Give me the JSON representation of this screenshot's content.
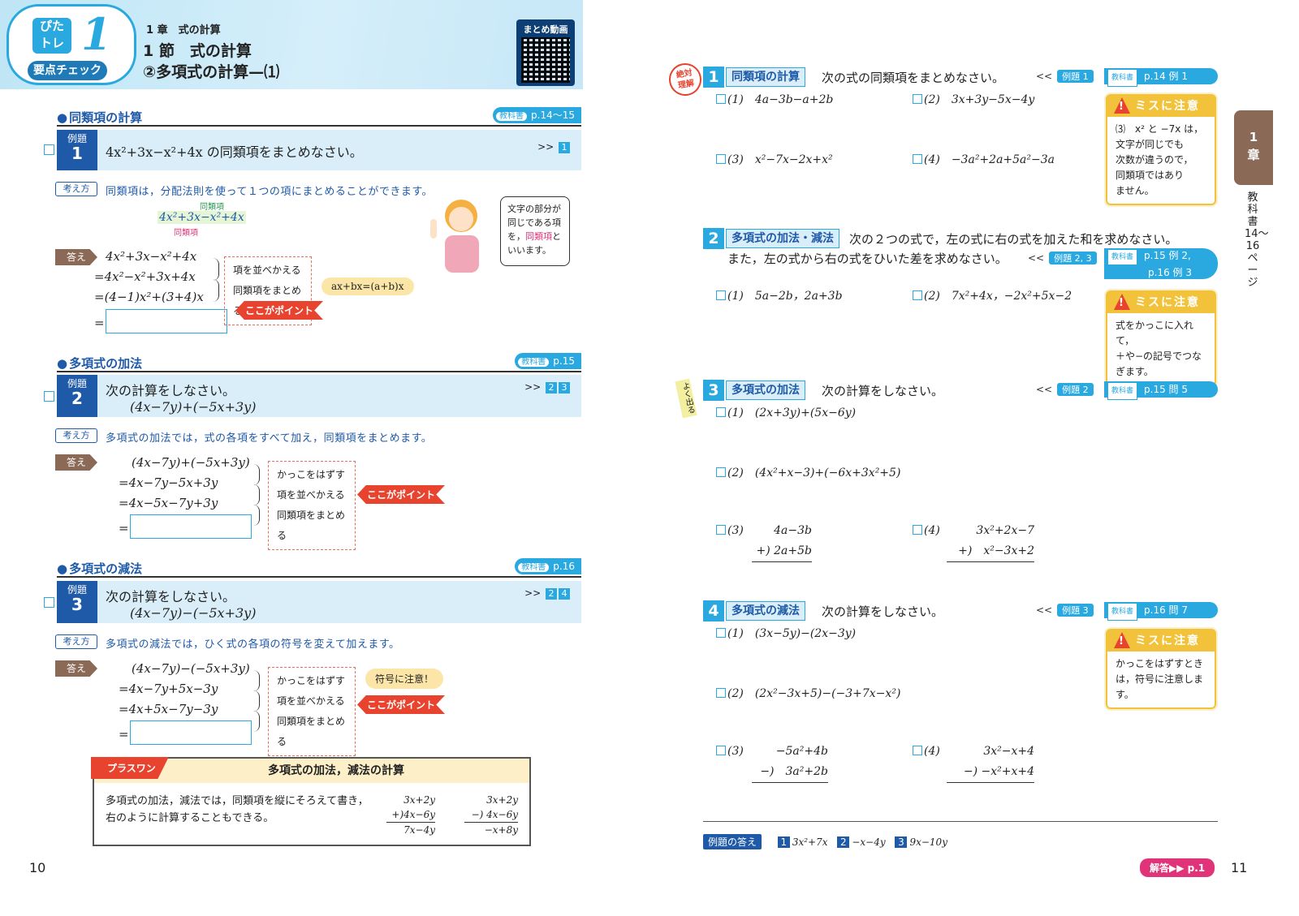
{
  "left": {
    "badge": {
      "pita": "ぴた\nトレ",
      "num": "1",
      "yoten": "要点チェック"
    },
    "chapter": "1 章　式の計算",
    "section": "1 節　式の計算",
    "subsection": "②多項式の計算—⑴",
    "qr_label": "まとめ動画",
    "s1": {
      "title": "同類項の計算",
      "tag_small": "教科書",
      "tag": "p.14〜15",
      "ex_label": "例題",
      "ex_num": "1",
      "question": "4x²+3x−x²+4x の同類項をまとめなさい。",
      "ref": ">>",
      "refs": [
        "1"
      ],
      "kk": "考え方",
      "kk_text": "同類項は，分配法則を使って１つの項にまとめることができます。",
      "diagram": "4x²+3x−x²+4x",
      "diag_top": "同類項",
      "diag_bottom": "同類項",
      "ans": "答え",
      "lines": [
        "4x²+3x−x²+4x",
        "=4x²−x²+3x+4x",
        "=(4−1)x²+(3+4)x",
        "="
      ],
      "notes": [
        "項を並べかえる",
        "同類項をまとめる"
      ],
      "point": "ここがポイント",
      "bubble": "ax+bx=(a+b)x",
      "speech": [
        "文字の部分が",
        "同じである項",
        "を，",
        "同類項",
        "と",
        "いいます。"
      ]
    },
    "s2": {
      "title": "多項式の加法",
      "tag_small": "教科書",
      "tag": "p.15",
      "ex_label": "例題",
      "ex_num": "2",
      "q1": "次の計算をしなさい。",
      "q2": "(4x−7y)+(−5x+3y)",
      "ref": ">>",
      "refs": [
        "2",
        "3"
      ],
      "kk": "考え方",
      "kk_text": "多項式の加法では，式の各項をすべて加え，同類項をまとめます。",
      "ans": "答え",
      "lines": [
        "(4x−7y)+(−5x+3y)",
        "=4x−7y−5x+3y",
        "=4x−5x−7y+3y",
        "="
      ],
      "notes": [
        "かっこをはずす",
        "項を並べかえる",
        "同類項をまとめる"
      ],
      "point": "ここがポイント"
    },
    "s3": {
      "title": "多項式の減法",
      "tag_small": "教科書",
      "tag": "p.16",
      "ex_label": "例題",
      "ex_num": "3",
      "q1": "次の計算をしなさい。",
      "q2": "(4x−7y)−(−5x+3y)",
      "ref": ">>",
      "refs": [
        "2",
        "4"
      ],
      "kk": "考え方",
      "kk_text": "多項式の減法では，ひく式の各項の符号を変えて加えます。",
      "ans": "答え",
      "lines": [
        "(4x−7y)−(−5x+3y)",
        "=4x−7y+5x−3y",
        "=4x+5x−7y−3y",
        "="
      ],
      "notes": [
        "かっこをはずす",
        "項を並べかえる",
        "同類項をまとめる"
      ],
      "point": "ここがポイント",
      "bubble": "符号に注意！"
    },
    "plus": {
      "tag": "プラスワン",
      "title": "多項式の加法，減法の計算",
      "text1": "多項式の加法，減法では，同類項を縦にそろえて書き，",
      "text2": "右のように計算することもできる。",
      "c1": [
        "3x+2y",
        "+)4x−6y",
        "7x−4y"
      ],
      "c2": [
        "3x+2y",
        "−) 4x−6y",
        "−x+8y"
      ]
    },
    "page_num": "10"
  },
  "right": {
    "stamp": "絶対\n理解",
    "yoku": "よく出る",
    "q1": {
      "num": "1",
      "title": "同類項の計算",
      "text": "次の式の同類項をまとめなさい。",
      "ex": "例題 1",
      "tb_small": "教科書",
      "tb": "p.14 例 1",
      "items": [
        "(1)　4a−3b−a+2b",
        "(2)　3x+3y−5x−4y",
        "(3)　x²−7x−2x+x²",
        "(4)　−3a²+2a+5a²−3a"
      ],
      "warn_title": "ミスに注意",
      "warn": [
        "⑶　x² と −7x は，",
        "文字が同じでも",
        "次数が違うので，",
        "同類項ではあり",
        "ません。"
      ]
    },
    "q2": {
      "num": "2",
      "title": "多項式の加法・減法",
      "text1": "次の２つの式で，左の式に右の式を加えた和を求めなさい。",
      "text2": "また，左の式から右の式をひいた差を求めなさい。",
      "ex": "例題 2, 3",
      "tb_small": "教科書",
      "tb1": "p.15 例 2,",
      "tb2": "p.16 例 3",
      "items": [
        "(1)　5a−2b，2a+3b",
        "(2)　7x²+4x，−2x²+5x−2"
      ],
      "warn_title": "ミスに注意",
      "warn": [
        "式をかっこに入れて，",
        "＋や−の記号でつな",
        "ぎます。"
      ]
    },
    "q3": {
      "num": "3",
      "title": "多項式の加法",
      "text": "次の計算をしなさい。",
      "ex": "例題 2",
      "tb_small": "教科書",
      "tb": "p.15 問 5",
      "items": [
        "(1)　(2x+3y)+(5x−6y)",
        "(2)　(4x²+x−3)+(−6x+3x²+5)",
        "(3)",
        "(4)"
      ],
      "v3": [
        "4a−3b",
        "+) 2a+5b"
      ],
      "v4": [
        "3x²+2x−7",
        "+)　x²−3x+2"
      ]
    },
    "q4": {
      "num": "4",
      "title": "多項式の減法",
      "text": "次の計算をしなさい。",
      "ex": "例題 3",
      "tb_small": "教科書",
      "tb": "p.16 問 7",
      "items": [
        "(1)　(3x−5y)−(2x−3y)",
        "(2)　(2x²−3x+5)−(−3+7x−x²)",
        "(3)",
        "(4)"
      ],
      "v3": [
        "−5a²+4b",
        "−)　3a²+2b"
      ],
      "v4": [
        "3x²−x+4",
        "−) −x²+x+4"
      ],
      "warn_title": "ミスに注意",
      "warn": [
        "かっこをはずすとき",
        "は，符号に注意しま",
        "す。"
      ]
    },
    "tab": "1\n章",
    "vtext": "教科書14〜16ページ",
    "foot_label": "例題の答え",
    "foot": [
      {
        "n": "1",
        "a": "3x²+7x"
      },
      {
        "n": "2",
        "a": "−x−4y"
      },
      {
        "n": "3",
        "a": "9x−10y"
      }
    ],
    "kaito": "解答▶▶ p.1",
    "page_num": "11"
  }
}
